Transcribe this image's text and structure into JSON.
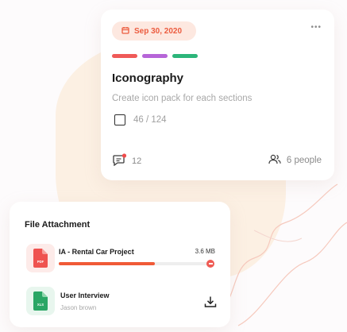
{
  "colors": {
    "accent": "#ec5c3f",
    "pill_bg": "#fde8e0",
    "label_red": "#ef5a58",
    "label_purple": "#b665d8",
    "label_green": "#2cb57a",
    "progress": "#f05a37",
    "pdf_red": "#ef5350",
    "xls_green": "#2aa665"
  },
  "task_card": {
    "date": "Sep 30, 2020",
    "more_label": "•••",
    "labels": [
      "red",
      "purple",
      "green"
    ],
    "title": "Iconography",
    "description": "Create icon pack for each sections",
    "checklist_count": "46 / 124",
    "comment_count": "12",
    "people_count": "6 people",
    "icons": {
      "date": "calendar-icon",
      "comments": "comment-icon",
      "people": "people-icon"
    }
  },
  "attachments": {
    "title": "File Attachment",
    "files": [
      {
        "name": "IA - Rental Car Project",
        "size": "3.6 MB",
        "type_label": "PDF",
        "progress_fraction": 0.62,
        "icon": "pdf-file-icon"
      },
      {
        "name": "User Interview",
        "author": "Jason brown",
        "type_label": "XLS",
        "icon": "xls-file-icon",
        "action_icon": "download-icon"
      }
    ]
  }
}
